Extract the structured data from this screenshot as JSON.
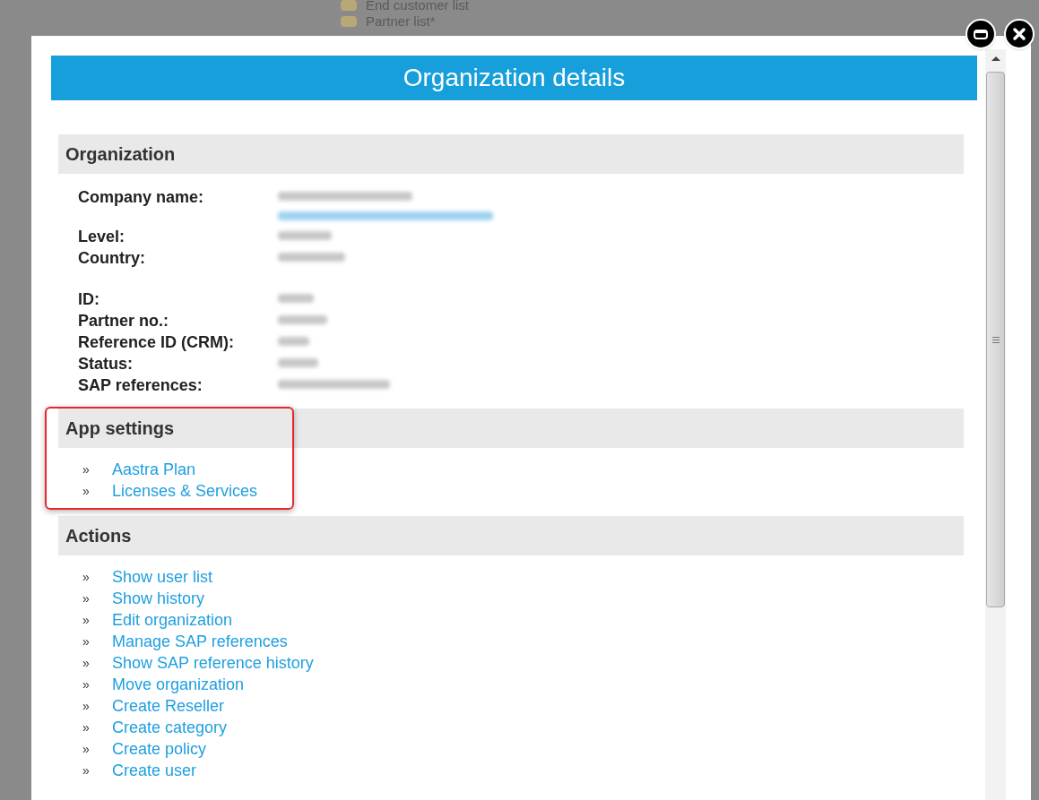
{
  "background_items": [
    "End customer list",
    "Partner list*"
  ],
  "dialog": {
    "title": "Organization details"
  },
  "organization": {
    "heading": "Organization",
    "groups": [
      {
        "fields": [
          {
            "label": "Company name:",
            "kind": "with_link"
          },
          {
            "label": "Level:",
            "kind": "plain"
          },
          {
            "label": "Country:",
            "kind": "plain"
          }
        ]
      },
      {
        "fields": [
          {
            "label": "ID:",
            "kind": "plain"
          },
          {
            "label": "Partner no.:",
            "kind": "plain"
          },
          {
            "label": "Reference ID (CRM):",
            "kind": "plain"
          },
          {
            "label": "Status:",
            "kind": "plain"
          },
          {
            "label": "SAP references:",
            "kind": "plain"
          }
        ]
      }
    ]
  },
  "app_settings": {
    "heading": "App settings",
    "highlighted": true,
    "bullet": "»",
    "links": [
      "Aastra Plan",
      "Licenses & Services"
    ]
  },
  "actions": {
    "heading": "Actions",
    "bullet": "»",
    "links": [
      "Show user list",
      "Show history",
      "Edit organization",
      "Manage SAP references",
      "Show SAP reference history",
      "Move organization",
      "Create Reseller",
      "Create category",
      "Create policy",
      "Create user"
    ]
  }
}
